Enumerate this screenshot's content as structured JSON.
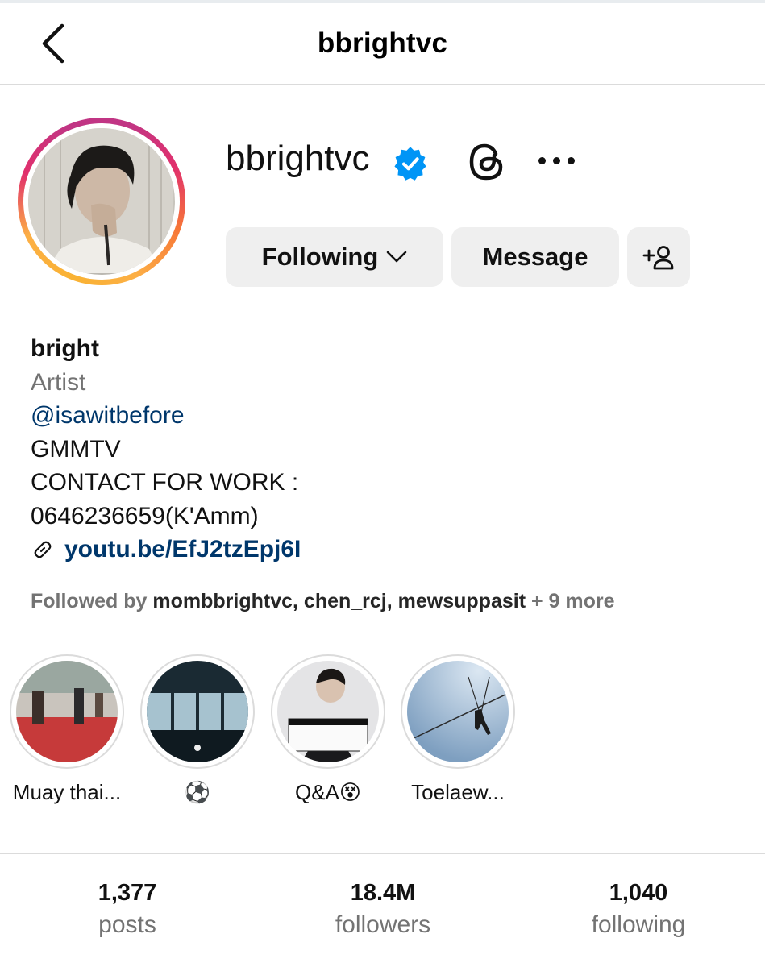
{
  "header": {
    "title": "bbrightvc"
  },
  "profile": {
    "username": "bbrightvc",
    "verified": true,
    "buttons": {
      "following": "Following",
      "message": "Message"
    }
  },
  "bio": {
    "name": "bright",
    "category": "Artist",
    "mention": "@isawitbefore",
    "lines": [
      "GMMTV",
      "CONTACT FOR WORK :",
      "0646236659(K'Amm)"
    ],
    "link": "youtu.be/EfJ2tzEpj6I"
  },
  "followed_by": {
    "prefix": "Followed by ",
    "names": "mombbrightvc, chen_rcj, mewsuppasit",
    "suffix": " + 9 more"
  },
  "highlights": [
    {
      "label": "Muay thai..."
    },
    {
      "label": "⚽"
    },
    {
      "label": "Q&A😵"
    },
    {
      "label": "Toelaew..."
    }
  ],
  "stats": {
    "posts": {
      "value": "1,377",
      "label": "posts"
    },
    "followers": {
      "value": "18.4M",
      "label": "followers"
    },
    "following": {
      "value": "1,040",
      "label": "following"
    }
  },
  "colors": {
    "link": "#00376b",
    "verified": "#0095f6",
    "muted": "#737373",
    "button_bg": "#efefef"
  }
}
